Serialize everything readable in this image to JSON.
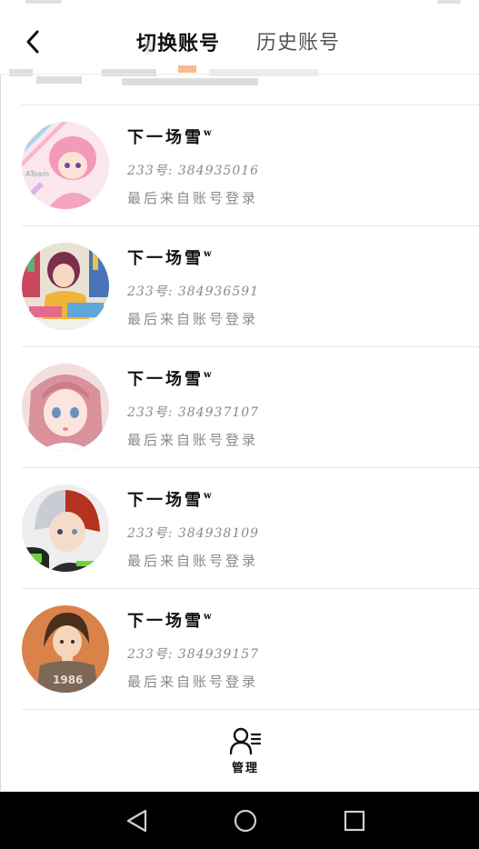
{
  "header": {
    "tabs": [
      {
        "label": "切换账号",
        "active": true
      },
      {
        "label": "历史账号",
        "active": false
      }
    ]
  },
  "accounts": [
    {
      "name": "下一场雪",
      "name_suffix": "w",
      "id": "233号: 384935016",
      "source": "最后来自账号登录",
      "avatar_icon": "avatar-pink-hair-girl"
    },
    {
      "name": "下一场雪",
      "name_suffix": "w",
      "id": "233号: 384936591",
      "source": "最后来自账号登录",
      "avatar_icon": "avatar-girl-with-books"
    },
    {
      "name": "下一场雪",
      "name_suffix": "w",
      "id": "233号: 384937107",
      "source": "最后来自账号登录",
      "avatar_icon": "avatar-anime-girl-pink"
    },
    {
      "name": "下一场雪",
      "name_suffix": "w",
      "id": "233号: 384938109",
      "source": "最后来自账号登录",
      "avatar_icon": "avatar-anime-boy-two-tone"
    },
    {
      "name": "下一场雪",
      "name_suffix": "w",
      "id": "233号: 384939157",
      "source": "最后来自账号登录",
      "avatar_icon": "avatar-girl-orange-bg"
    }
  ],
  "manage": {
    "label": "管理",
    "icon": "user-list-icon"
  },
  "nav": {
    "icons": [
      "back-triangle-icon",
      "home-circle-icon",
      "recents-square-icon"
    ]
  },
  "colors": {
    "background": "#ffffff",
    "text_primary": "#111111",
    "text_secondary": "#8a8a8a",
    "nav_bar": "#000000"
  }
}
